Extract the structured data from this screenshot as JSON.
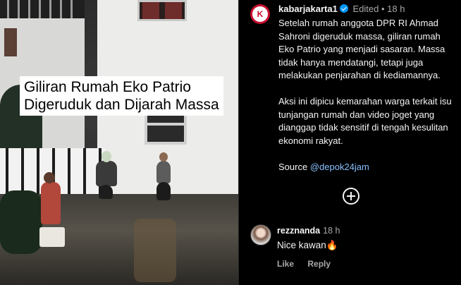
{
  "media": {
    "caption_line1": "Giliran Rumah Eko Patrio",
    "caption_line2": "Digeruduk dan Dijarah Massa"
  },
  "post": {
    "avatar_letter": "K",
    "username": "kabarjakarta1",
    "edited_label": "Edited",
    "separator": "•",
    "time": "18 h",
    "paragraph1": "Setelah rumah anggota DPR RI Ahmad Sahroni digeruduk massa, giliran rumah Eko Patrio yang menjadi sasaran. Massa tidak hanya mendatangi, tetapi juga melakukan penjarahan di kediamannya.",
    "paragraph2": "Aksi ini dipicu kemarahan warga terkait isu tunjangan rumah dan video joget yang dianggap tidak sensitif di tengah kesulitan ekonomi rakyat.",
    "source_label": "Source",
    "source_handle": "@depok24jam"
  },
  "comment": {
    "username": "rezznanda",
    "time": "18 h",
    "text": "Nice kawan",
    "emoji": "🔥",
    "like_label": "Like",
    "reply_label": "Reply"
  },
  "colors": {
    "accent_link": "#88c0ff",
    "verified": "#0095f6",
    "brand": "#c8102e"
  }
}
